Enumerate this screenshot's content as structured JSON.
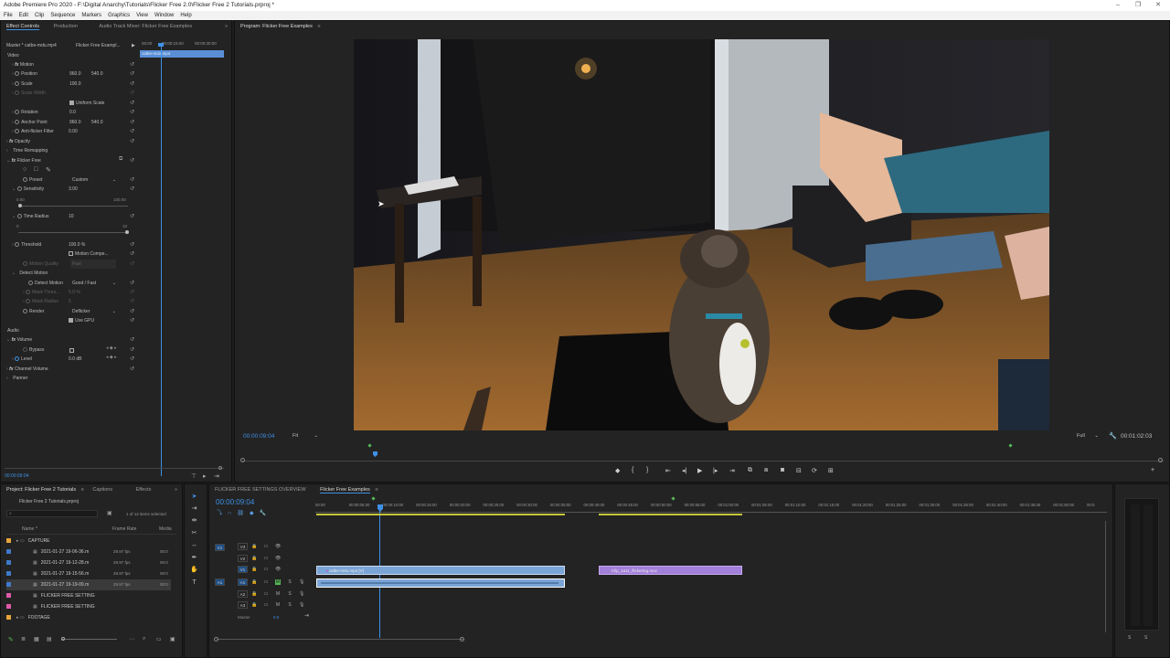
{
  "app": {
    "title": "Adobe Premiere Pro 2020 - F:\\Digital Anarchy\\Tutorials\\Flicker Free 2.0\\Flicker Free 2 Tutorials.prproj *",
    "menus": [
      "File",
      "Edit",
      "Clip",
      "Sequence",
      "Markers",
      "Graphics",
      "View",
      "Window",
      "Help"
    ]
  },
  "source_panel": {
    "tabs": [
      "Effect Controls",
      "Production",
      "Audio Track Mixer: Flicker Free Examples"
    ],
    "master_label": "Master * catbe-mdu.mp4",
    "seq_label": "Flicker Free Exampl...",
    "mini_tc": [
      "00:00",
      "00:00:15:00",
      "00:00:30:00"
    ],
    "clip_name": "catbe-mdu.mp4",
    "video_label": "Video",
    "motion": "Motion",
    "position": "Position",
    "pos_x": "960.0",
    "pos_y": "540.0",
    "scale": "Scale",
    "scale_val": "100.0",
    "scale_width": "Scale Width",
    "uniform_scale": "Uniform Scale",
    "rotation": "Rotation",
    "rotation_val": "0.0",
    "anchor": "Anchor Point",
    "anchor_x": "960.0",
    "anchor_y": "540.0",
    "anti_flicker": "Anti-flicker Filter",
    "anti_flicker_val": "0.00",
    "opacity": "Opacity",
    "time_remap": "Time Remapping",
    "flicker_free": "Flicker Free",
    "preset": "Preset",
    "preset_val": "Custom",
    "sensitivity": "Sensitivity",
    "sensitivity_val": "3.00",
    "sens_min": "0.00",
    "sens_max": "100.00",
    "time_radius": "Time Radius",
    "time_radius_val": "10",
    "tr_min": "0",
    "tr_max": "10",
    "threshold": "Threshold",
    "threshold_val": "100.0 %",
    "motion_comp": "Motion Compe...",
    "motion_quality": "Motion Quality",
    "motion_quality_val": "Fast",
    "detect_motion_group": "Detect Motion",
    "detect_motion": "Detect Motion",
    "detect_motion_val": "Good / Fast",
    "mask_thresh": "Mask Thres...",
    "mask_thresh_val": "5.0 %",
    "mask_radius": "Mask Radius",
    "mask_radius_val": "5",
    "render": "Render",
    "render_val": "Deflicker",
    "use_gpu": "Use GPU",
    "audio_label": "Audio",
    "volume": "Volume",
    "bypass": "Bypass",
    "level": "Level",
    "level_val": "0.0 dB",
    "channel_volume": "Channel Volume",
    "panner": "Panner",
    "timecode": "00:00:09:04"
  },
  "program": {
    "title": "Program: Flicker Free Examples",
    "timecode": "00:00:09:04",
    "fit": "Fit",
    "quality": "Full",
    "duration": "00:01:02:03"
  },
  "project": {
    "tabs": [
      "Project: Flicker Free 2 Tutorials",
      "Captions",
      "Effects"
    ],
    "file": "Flicker Free 2 Tutorials.prproj",
    "count": "1 of 12 items selected",
    "columns": [
      "Name",
      "Frame Rate",
      "Media"
    ],
    "rows": [
      {
        "name": "CAPTURE",
        "fps": "",
        "media": "",
        "color": "#e8a53b",
        "indent": 0
      },
      {
        "name": "2021-01-27 19-06-36.m",
        "fps": "29.97 fps",
        "media": "00:0",
        "color": "#3e7ac9",
        "indent": 1
      },
      {
        "name": "2021-01-27 19-12-28.m",
        "fps": "29.97 fps",
        "media": "00:0",
        "color": "#3e7ac9",
        "indent": 1
      },
      {
        "name": "2021-01-27 19-15-56.m",
        "fps": "29.97 fps",
        "media": "00:0",
        "color": "#3e7ac9",
        "indent": 1
      },
      {
        "name": "2021-01-27 19-19-09.m",
        "fps": "29.97 fps",
        "media": "00:0",
        "color": "#3e7ac9",
        "indent": 1
      },
      {
        "name": "FLICKER FREE SETTING",
        "fps": "",
        "media": "",
        "color": "#e05aa8",
        "indent": 1
      },
      {
        "name": "FLICKER FREE SETTING",
        "fps": "",
        "media": "",
        "color": "#e05aa8",
        "indent": 1
      },
      {
        "name": "FOOTAGE",
        "fps": "",
        "media": "",
        "color": "#e8a53b",
        "indent": 0
      }
    ]
  },
  "timeline": {
    "tabs": [
      "FLICKER FREE SETTINGS OVERVIEW",
      "Flicker Free Examples"
    ],
    "timecode": "00:00:09:04",
    "ruler": [
      "00:00",
      "00:00:05:00",
      "00:00:10:00",
      "00:00:15:00",
      "00:00:20:00",
      "00:00:25:00",
      "00:00:30:00",
      "00:00:35:00",
      "00:00:40:00",
      "00:00:45:00",
      "00:00:50:00",
      "00:00:55:00",
      "00:01:00:00",
      "00:01:05:00",
      "00:01:10:00",
      "00:01:15:00",
      "00:01:20:00",
      "00:01:25:00",
      "00:01:30:00",
      "00:01:35:00",
      "00:01:40:00",
      "00:01:45:00",
      "00:01:50:00",
      "00:0"
    ],
    "tracks": [
      "V3",
      "V2",
      "V1",
      "A1",
      "A2",
      "A3"
    ],
    "src_v": "V1",
    "src_a": "A1",
    "master": "Master",
    "master_val": "0.0",
    "clip1": "catbe-mdu.mp4 [V]",
    "clip2": "Clip_1a11_flickering.mov"
  }
}
